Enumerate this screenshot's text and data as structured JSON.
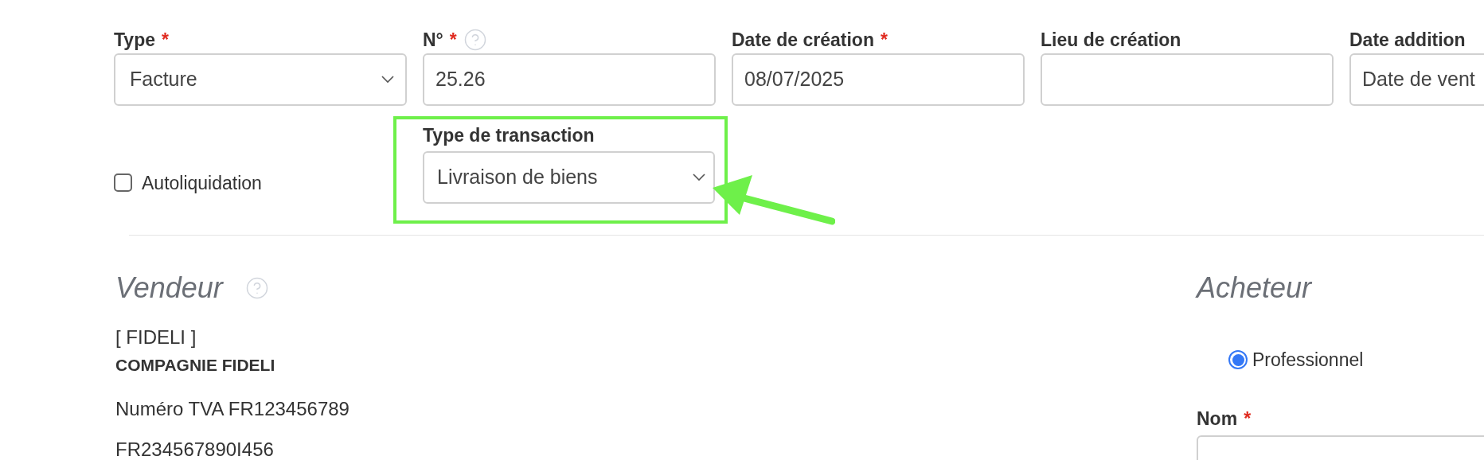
{
  "fields": [
    {
      "label": "Type",
      "required_mark": "*",
      "help": false,
      "kind": "select",
      "value": "Facture"
    },
    {
      "label": "N°",
      "required_mark": "*",
      "help": true,
      "kind": "text",
      "value": "25.26"
    },
    {
      "label": "Date de création",
      "required_mark": "*",
      "help": false,
      "kind": "text",
      "value": "08/07/2025"
    },
    {
      "label": "Lieu de création",
      "help": false,
      "kind": "text"
    },
    {
      "label": "Date addition",
      "help": false,
      "kind": "text",
      "value": "Date de vent"
    }
  ],
  "autoliquidation": {
    "label": "Autoliquidation",
    "checked": false
  },
  "transaction": {
    "label": "Type de transaction",
    "value": "Livraison de biens",
    "highlighted": true
  },
  "vendeur": {
    "title": "Vendeur",
    "help": true,
    "code": "[ FIDELI ]",
    "name": "COMPAGNIE FIDELI",
    "vat": "Numéro TVA FR123456789",
    "line": "FR234567890I456"
  },
  "acheteur": {
    "title": "Acheteur",
    "radio": {
      "label": "Professionnel",
      "selected": true
    },
    "field": {
      "label": "Nom",
      "required_mark": "*"
    }
  }
}
